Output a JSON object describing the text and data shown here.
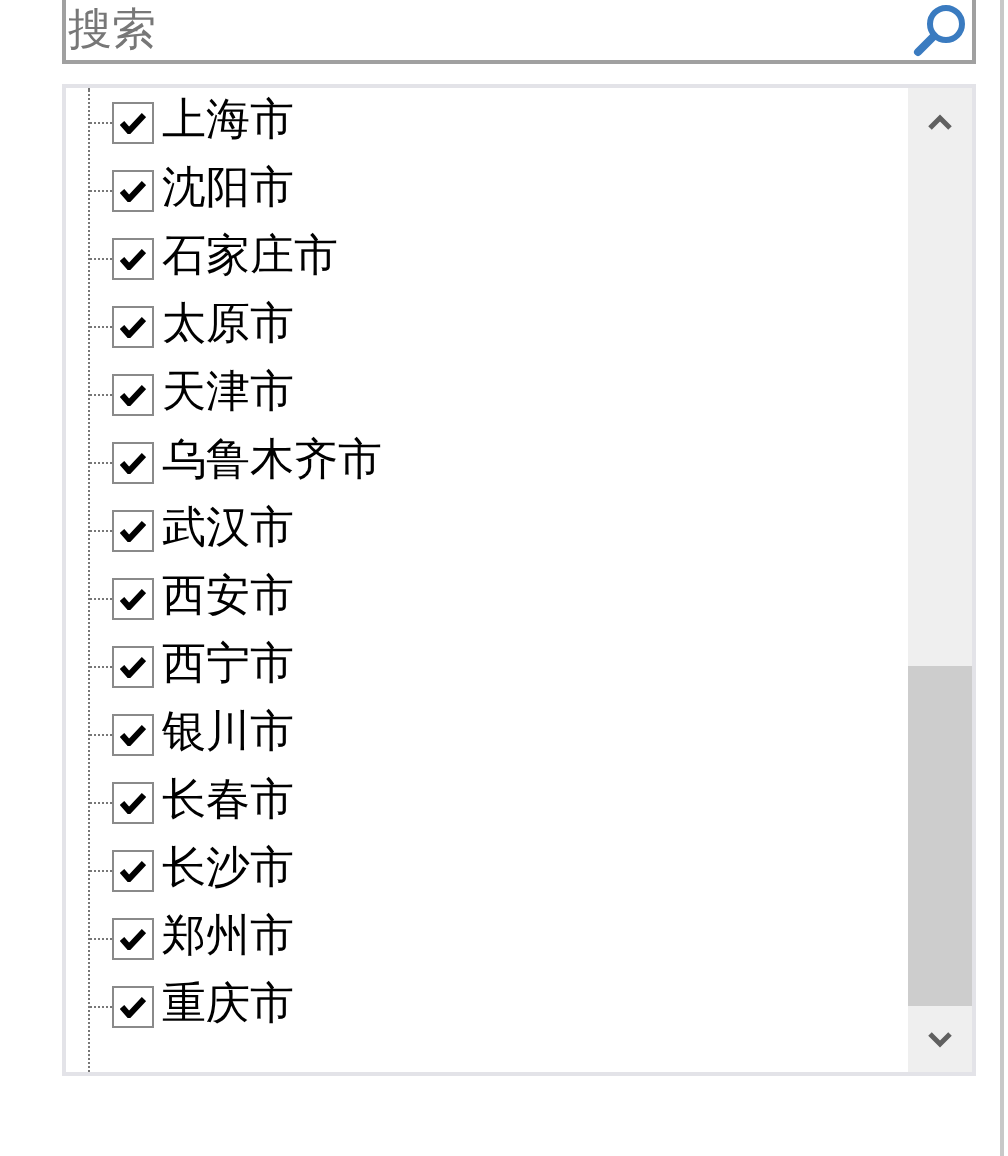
{
  "search": {
    "placeholder": "搜索"
  },
  "items": [
    {
      "label": "上海市",
      "checked": true
    },
    {
      "label": "沈阳市",
      "checked": true
    },
    {
      "label": "石家庄市",
      "checked": true
    },
    {
      "label": "太原市",
      "checked": true
    },
    {
      "label": "天津市",
      "checked": true
    },
    {
      "label": "乌鲁木齐市",
      "checked": true
    },
    {
      "label": "武汉市",
      "checked": true
    },
    {
      "label": "西安市",
      "checked": true
    },
    {
      "label": "西宁市",
      "checked": true
    },
    {
      "label": "银川市",
      "checked": true
    },
    {
      "label": "长春市",
      "checked": true
    },
    {
      "label": "长沙市",
      "checked": true
    },
    {
      "label": "郑州市",
      "checked": true
    },
    {
      "label": "重庆市",
      "checked": true
    }
  ]
}
